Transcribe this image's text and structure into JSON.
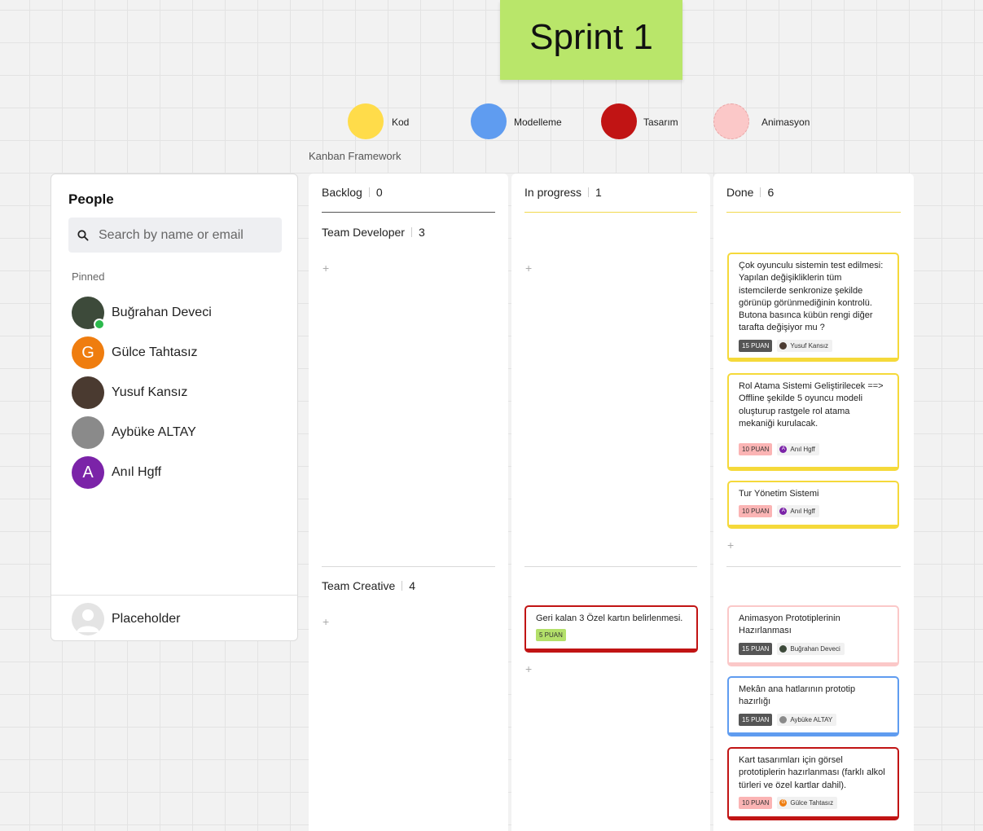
{
  "board": {
    "sticky_title": "Sprint 1",
    "framework_label": "Kanban Framework",
    "legend": [
      {
        "label": "Kod",
        "color": "#ffdc4a"
      },
      {
        "label": "Modelleme",
        "color": "#5f9cf0"
      },
      {
        "label": "Tasarım",
        "color": "#c11414"
      },
      {
        "label": "Animasyon",
        "color": "#fbc8c8"
      }
    ]
  },
  "people": {
    "title": "People",
    "search_placeholder": "Search by name or email",
    "pinned_label": "Pinned",
    "list": [
      {
        "name": "Buğrahan Deveci",
        "initial": "",
        "avatar_color": "#3d4a3a",
        "online": true
      },
      {
        "name": "Gülce Tahtasız",
        "initial": "G",
        "avatar_color": "#ef7d0f",
        "online": false
      },
      {
        "name": "Yusuf Kansız",
        "initial": "",
        "avatar_color": "#4a3a30",
        "online": false
      },
      {
        "name": "Aybüke ALTAY",
        "initial": "",
        "avatar_color": "#8a8a8a",
        "online": false
      },
      {
        "name": "Anıl Hgff",
        "initial": "A",
        "avatar_color": "#7b23a8",
        "online": false
      }
    ],
    "placeholder_name": "Placeholder"
  },
  "columns": [
    {
      "name": "Backlog",
      "count": "0",
      "line_color": "#555555"
    },
    {
      "name": "In progress",
      "count": "1",
      "line_color": "#f2d94e"
    },
    {
      "name": "Done",
      "count": "6",
      "line_color": "#f2d94e"
    }
  ],
  "lanes": [
    {
      "name": "Team Developer",
      "count": "3"
    },
    {
      "name": "Team Creative",
      "count": "4"
    }
  ],
  "add_symbol": "+",
  "cards": {
    "done_dev": [
      {
        "text": "Çok oyunculu sistemin test edilmesi: Yapılan değişikliklerin tüm istemcilerde senkronize şekilde görünüp görünmediğinin kontrolü. Butona basınca kübün rengi diğer tarafta değişiyor mu ?",
        "points": "15 PUAN",
        "assignee": "Yusuf Kansız",
        "initial": "",
        "assignee_color": "#4a3a30",
        "border_color": "#f5d93a",
        "tag_bg": "#555555",
        "tag_fg": "#ffffff"
      },
      {
        "text": "Rol Atama Sistemi Geliştirilecek ==> Offline şekilde 5 oyuncu modeli oluşturup rastgele rol atama mekaniği kurulacak.",
        "points": "10 PUAN",
        "assignee": "Anıl Hgff",
        "initial": "A",
        "assignee_color": "#7b23a8",
        "border_color": "#f5d93a",
        "tag_bg": "#fbb4b4",
        "tag_fg": "#333333"
      },
      {
        "text": "Tur Yönetim Sistemi",
        "points": "10 PUAN",
        "assignee": "Anıl Hgff",
        "initial": "A",
        "assignee_color": "#7b23a8",
        "border_color": "#f5d93a",
        "tag_bg": "#fbb4b4",
        "tag_fg": "#333333"
      }
    ],
    "progress_creative": [
      {
        "text": "Geri kalan 3 Özel kartın belirlenmesi.",
        "points": "5 PUAN",
        "border_color": "#c11414",
        "tag_bg": "#b3e06a",
        "tag_fg": "#333333"
      }
    ],
    "done_creative": [
      {
        "text": "Animasyon Prototiplerinin Hazırlanması",
        "points": "15 PUAN",
        "assignee": "Buğrahan Deveci",
        "initial": "",
        "assignee_color": "#3d4a3a",
        "border_color": "#fbc8c8",
        "tag_bg": "#555555",
        "tag_fg": "#ffffff"
      },
      {
        "text": "Mekân ana hatlarının prototip hazırlığı",
        "points": "15 PUAN",
        "assignee": "Aybüke ALTAY",
        "initial": "",
        "assignee_color": "#8a8a8a",
        "border_color": "#5f9cf0",
        "tag_bg": "#555555",
        "tag_fg": "#ffffff"
      },
      {
        "text": "Kart tasarımları için görsel prototiplerin hazırlanması (farklı alkol türleri ve özel kartlar dahil).",
        "points": "10 PUAN",
        "assignee": "Gülce Tahtasız",
        "initial": "G",
        "assignee_color": "#ef7d0f",
        "border_color": "#c11414",
        "tag_bg": "#fbb4b4",
        "tag_fg": "#333333"
      }
    ]
  }
}
